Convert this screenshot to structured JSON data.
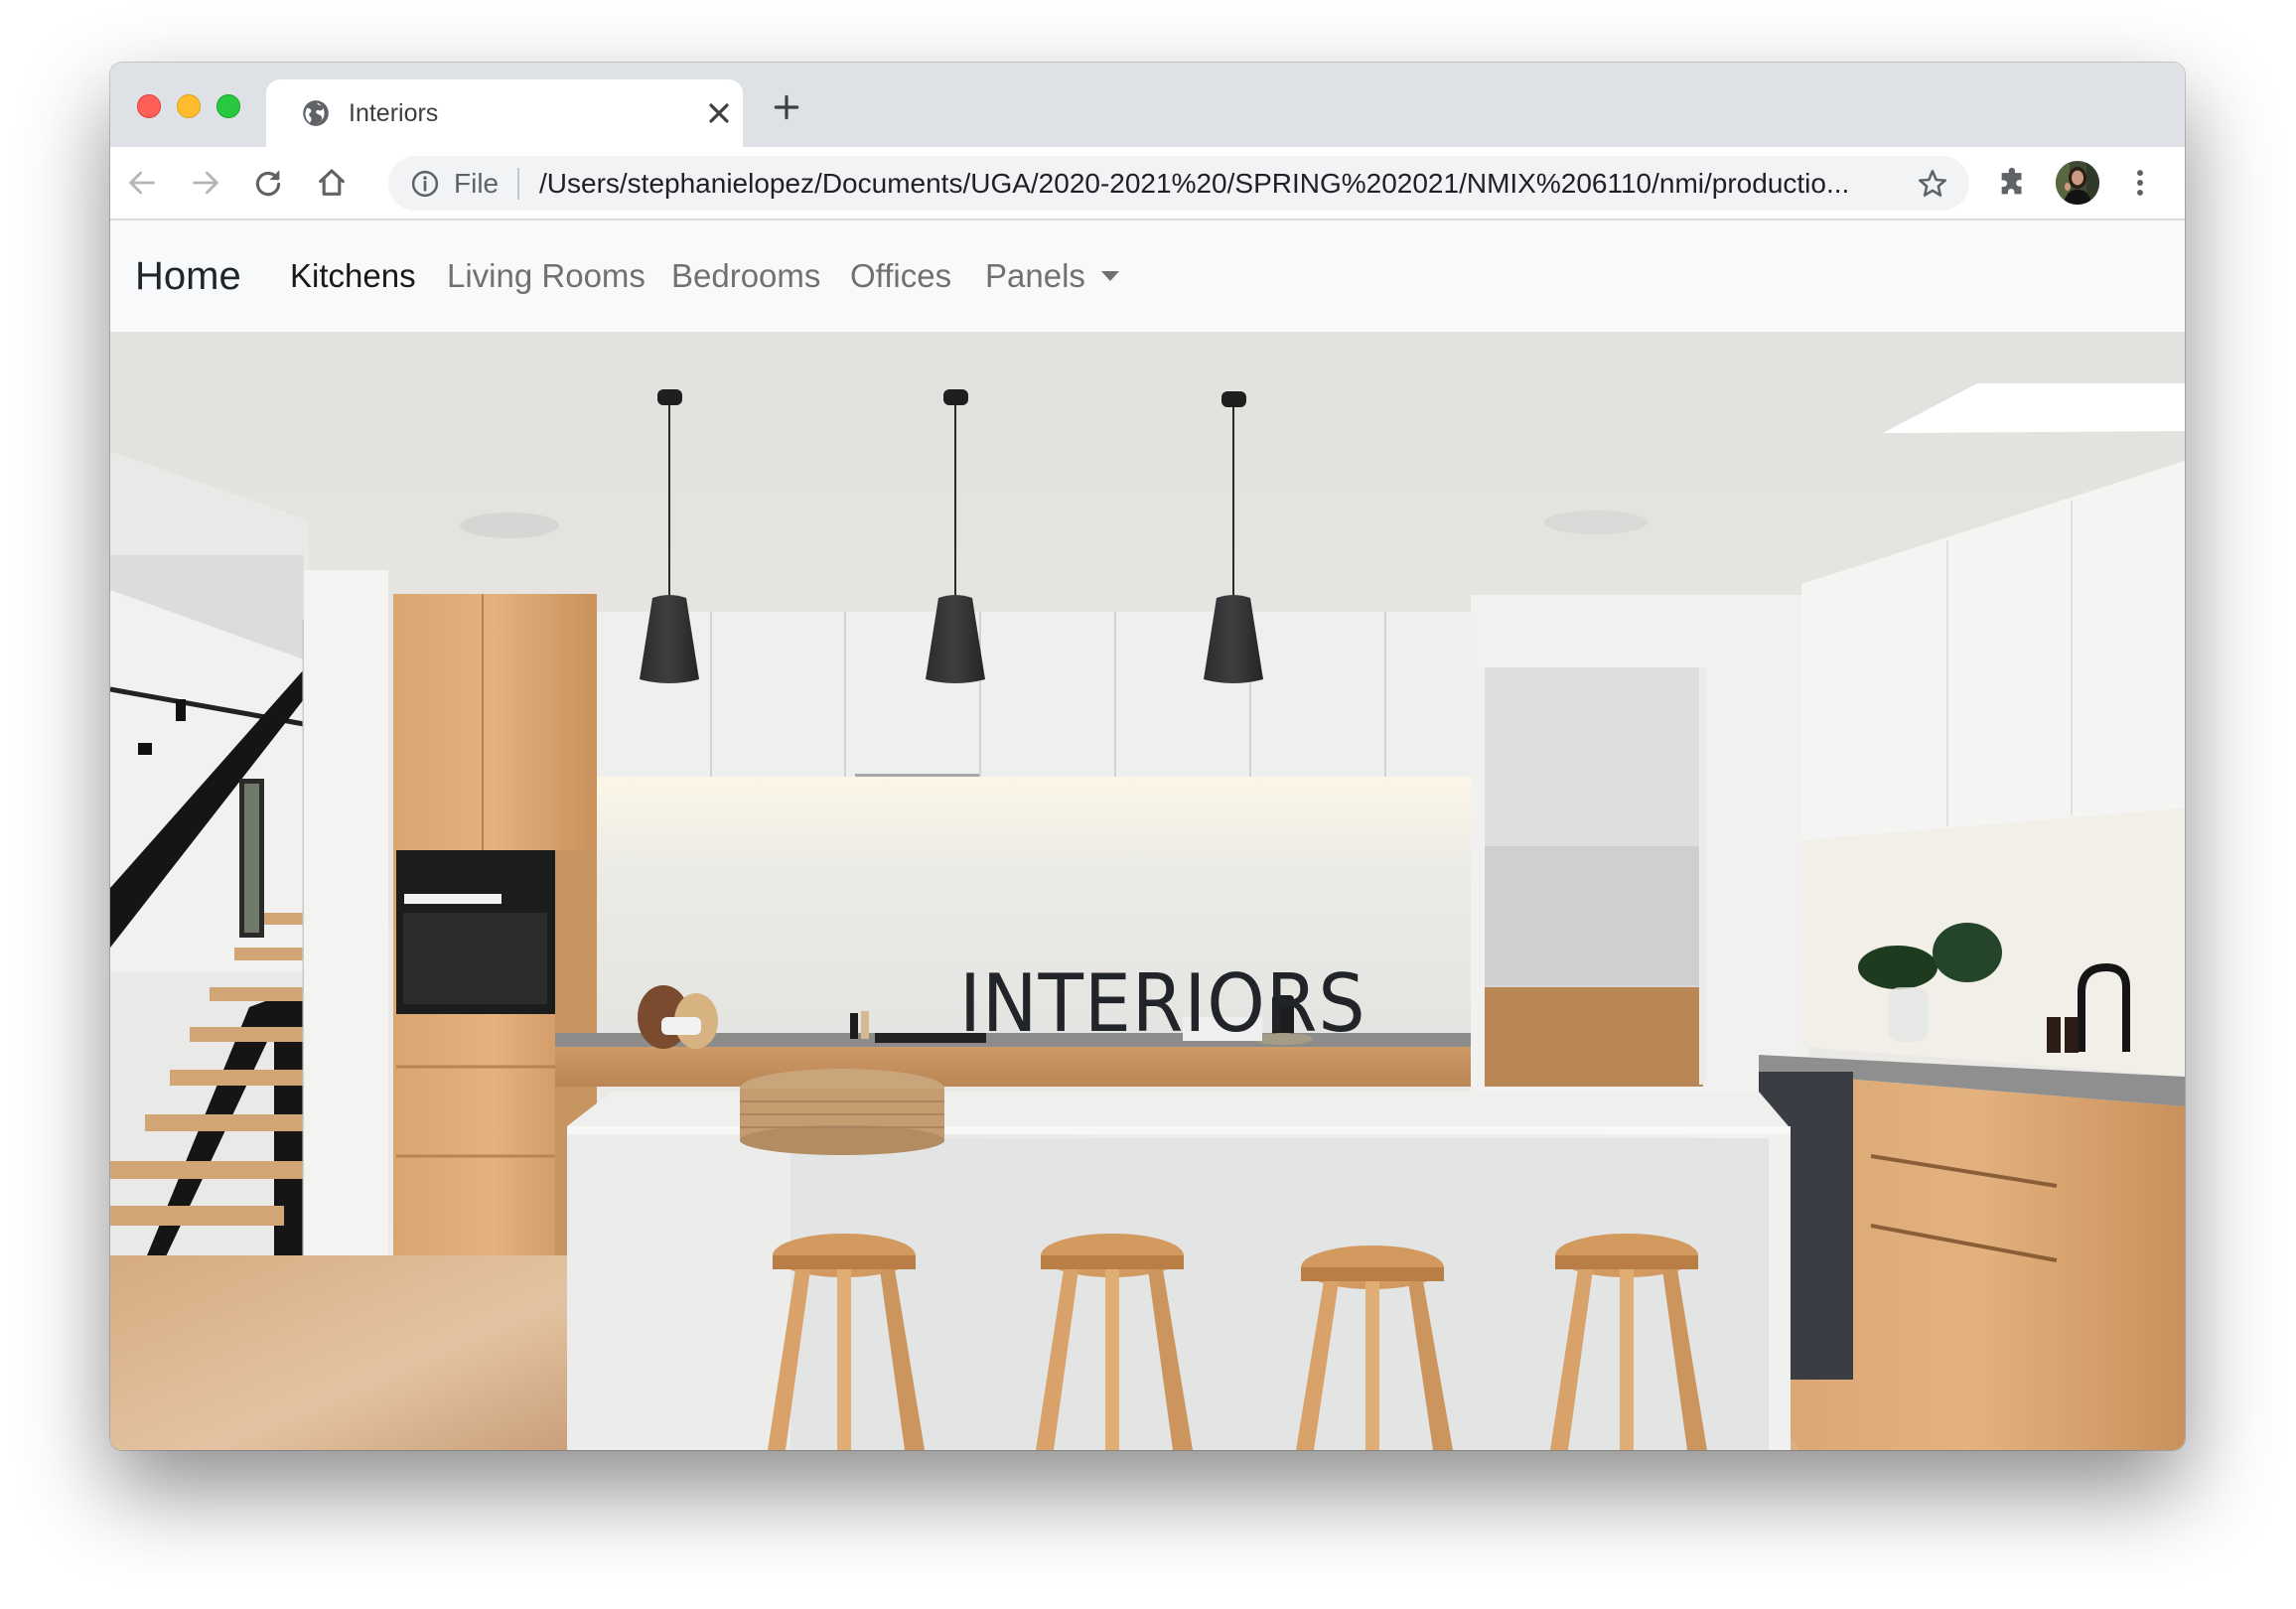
{
  "browser": {
    "tab": {
      "title": "Interiors",
      "favicon": "globe-icon",
      "close_icon": "close-icon"
    },
    "new_tab_icon": "plus-icon",
    "toolbar": {
      "back_icon": "arrow-left-icon",
      "forward_icon": "arrow-right-icon",
      "reload_icon": "reload-icon",
      "home_icon": "home-icon",
      "extensions_icon": "puzzle-icon",
      "profile_icon": "avatar",
      "menu_icon": "more-vertical-icon"
    },
    "omnibox": {
      "info_icon": "info-icon",
      "scheme_label": "File",
      "url": "/Users/stephanielopez/Documents/UGA/2020-2021%20/SPRING%202021/NMIX%206110/nmi/productio...",
      "bookmark_icon": "star-icon"
    },
    "colors": {
      "tabstrip": "#dee1e6",
      "omnibox": "#f1f3f4",
      "close": "#fe5f57",
      "minimize": "#febc2e",
      "maximize": "#28c840"
    }
  },
  "navbar": {
    "brand": "Home",
    "items": [
      {
        "label": "Kitchens",
        "active": true
      },
      {
        "label": "Living Rooms",
        "active": false
      },
      {
        "label": "Bedrooms",
        "active": false
      },
      {
        "label": "Offices",
        "active": false
      },
      {
        "label": "Panels",
        "active": false,
        "dropdown": true
      }
    ],
    "background": "#f8f9fa"
  },
  "hero": {
    "image_description": "modern kitchen with white cabinets, wood tall cabinet with built-in oven, three black pendant lights, white marble island with four wooden stools, open staircase at left",
    "overlay_title": "INTERIORS",
    "overlay_color": "#212529"
  }
}
